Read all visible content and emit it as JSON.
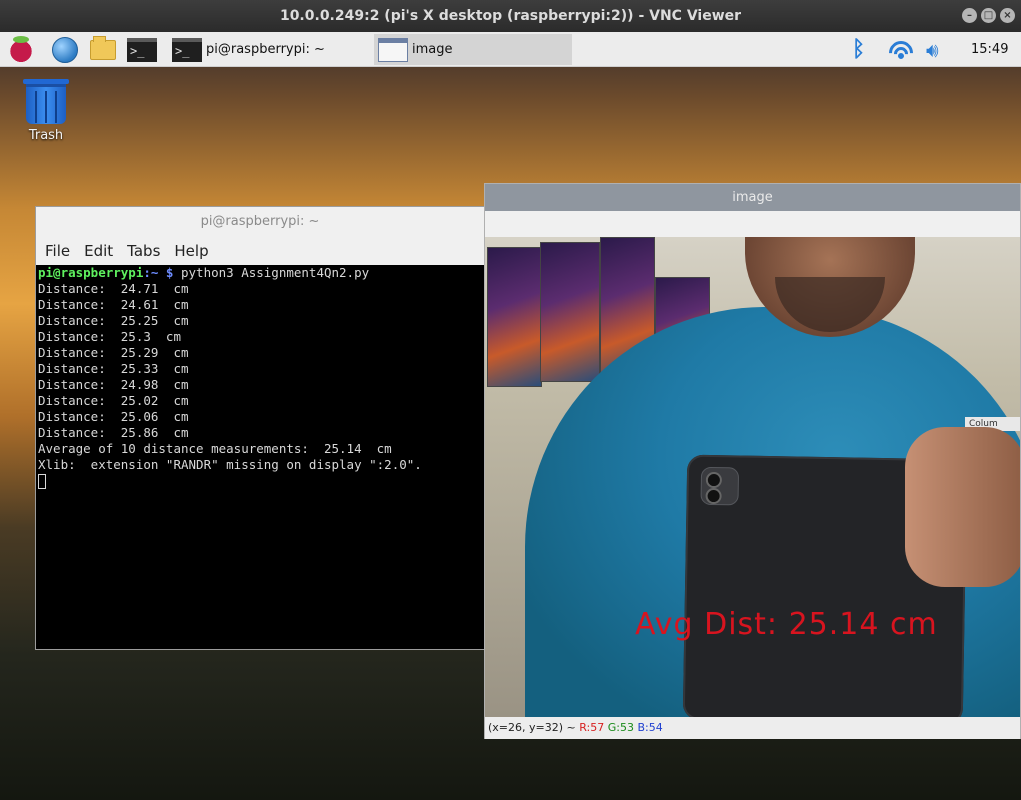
{
  "vnc": {
    "title": "10.0.0.249:2 (pi's X desktop (raspberrypi:2)) - VNC Viewer"
  },
  "taskbar": {
    "launchers": [
      {
        "name": "raspberry-menu-icon"
      },
      {
        "name": "web-browser-icon"
      },
      {
        "name": "file-manager-icon"
      },
      {
        "name": "terminal-icon"
      }
    ],
    "tasks": [
      {
        "label": "pi@raspberrypi: ~"
      },
      {
        "label": "image"
      }
    ],
    "tray": {
      "clock": "15:49"
    }
  },
  "desktop": {
    "trash_label": "Trash"
  },
  "terminal": {
    "title": "pi@raspberrypi: ~",
    "menu": [
      "File",
      "Edit",
      "Tabs",
      "Help"
    ],
    "prompt_user": "pi@raspberrypi",
    "prompt_path": ":~ $",
    "command": " python3 Assignment4Qn2.py",
    "lines": [
      "Distance:  24.71  cm",
      "Distance:  24.61  cm",
      "Distance:  25.25  cm",
      "Distance:  25.3  cm",
      "Distance:  25.29  cm",
      "Distance:  25.33  cm",
      "Distance:  24.98  cm",
      "Distance:  25.02  cm",
      "Distance:  25.06  cm",
      "Distance:  25.86  cm",
      "Average of 10 distance measurements:  25.14  cm",
      "Xlib:  extension \"RANDR\" missing on display \":2.0\"."
    ]
  },
  "image_window": {
    "title": "image",
    "overlay_text": "Avg Dist: 25.14  cm",
    "badge_text": "Colum",
    "status": {
      "coords": "(x=26, y=32) ~",
      "r": "R:57",
      "g": "G:53",
      "b": "B:54"
    }
  }
}
